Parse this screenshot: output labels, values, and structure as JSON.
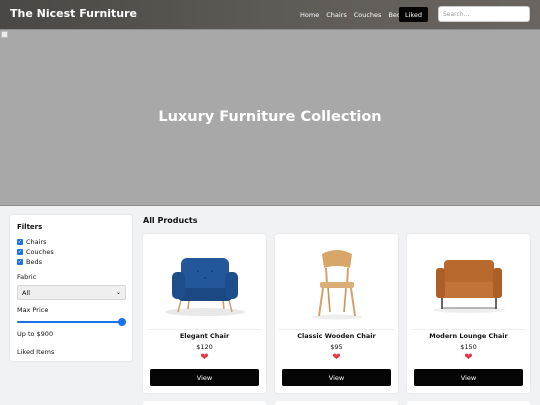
{
  "header": {
    "brand": "The Nicest Furniture",
    "nav": [
      "Home",
      "Chairs",
      "Couches",
      "Beds"
    ],
    "liked_label": "Liked",
    "search_placeholder": "Search..."
  },
  "hero": {
    "title": "Luxury Furniture Collection"
  },
  "filters": {
    "title": "Filters",
    "categories": [
      {
        "label": "Chairs",
        "checked": true
      },
      {
        "label": "Couches",
        "checked": true
      },
      {
        "label": "Beds",
        "checked": true
      }
    ],
    "fabric_label": "Fabric",
    "fabric_value": "All",
    "max_price_label": "Max Price",
    "max_price_fraction": 1.0,
    "max_price_text": "Up to $900",
    "liked_items_label": "Liked Items"
  },
  "products": {
    "title": "All Products",
    "items": [
      {
        "name": "Elegant Chair",
        "price": "$120",
        "view_label": "View",
        "icon": "armchair-icon",
        "color": "#1f4f8a"
      },
      {
        "name": "Classic Wooden Chair",
        "price": "$95",
        "view_label": "View",
        "icon": "wooden-chair-icon",
        "color": "#d7a86e"
      },
      {
        "name": "Modern Lounge Chair",
        "price": "$150",
        "view_label": "View",
        "icon": "lounge-chair-icon",
        "color": "#b5652c"
      }
    ]
  },
  "colors": {
    "accent": "#1a73e8",
    "button": "#050505",
    "heart": "#e63946"
  }
}
